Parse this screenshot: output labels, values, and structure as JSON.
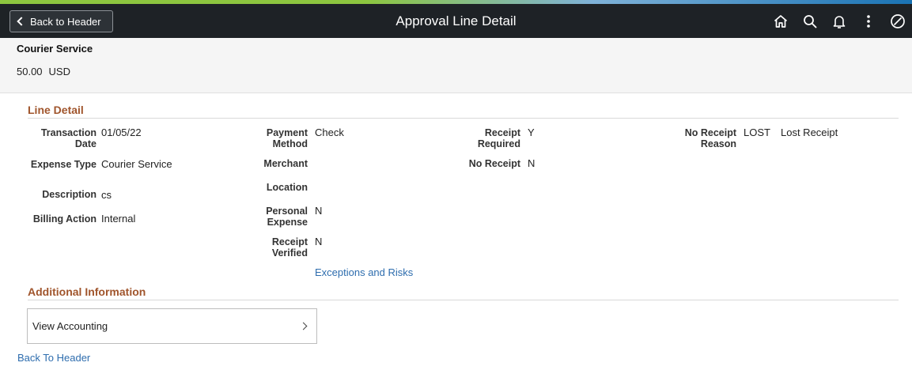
{
  "colors": {
    "accent_strip": "#8dc63f",
    "accent_strip_blue": "#1a73b4",
    "topbar": "#1e2226",
    "section_title": "#a0552c",
    "link": "#2e6dae"
  },
  "topbar": {
    "back_label": "Back to Header",
    "title": "Approval Line Detail",
    "icons": [
      "home-icon",
      "search-icon",
      "bell-icon",
      "more-vertical-icon",
      "compass-icon"
    ]
  },
  "summary": {
    "expense_type": "Courier Service",
    "amount": "50.00",
    "currency": "USD"
  },
  "line_detail": {
    "title": "Line Detail",
    "transaction_date": {
      "label": "Transaction Date",
      "value": "01/05/22"
    },
    "expense_type": {
      "label": "Expense Type",
      "value": "Courier Service"
    },
    "description": {
      "label": "Description",
      "value": "cs"
    },
    "billing_action": {
      "label": "Billing Action",
      "value": "Internal"
    },
    "payment_method": {
      "label": "Payment Method",
      "value": "Check"
    },
    "merchant": {
      "label": "Merchant",
      "value": ""
    },
    "location": {
      "label": "Location",
      "value": ""
    },
    "personal_expense": {
      "label": "Personal Expense",
      "value": "N"
    },
    "receipt_verified": {
      "label": "Receipt Verified",
      "value": "N"
    },
    "receipt_required": {
      "label": "Receipt Required",
      "value": "Y"
    },
    "no_receipt": {
      "label": "No Receipt",
      "value": "N"
    },
    "no_receipt_reason": {
      "label": "No Receipt Reason",
      "code": "LOST",
      "value": "Lost Receipt"
    },
    "exceptions_link": "Exceptions and Risks"
  },
  "additional_info": {
    "title": "Additional Information",
    "view_accounting": "View Accounting"
  },
  "footer": {
    "back_link": "Back To Header"
  }
}
